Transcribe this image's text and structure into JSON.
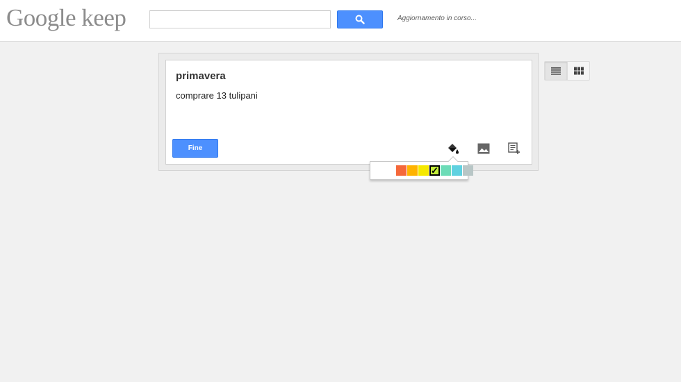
{
  "app": {
    "logo_text": "Google keep",
    "status_text": "Aggiornamento in corso..."
  },
  "search": {
    "value": "",
    "placeholder": "",
    "button_icon": "search-icon"
  },
  "note": {
    "title": "primavera",
    "body": "comprare 13 tulipani",
    "done_label": "Fine",
    "tools": [
      "color-fill-icon",
      "image-icon",
      "checklist-icon"
    ]
  },
  "palette": {
    "colors": [
      "#ffffff",
      "#f5683a",
      "#ffb300",
      "#f5e800",
      "#c4ef3a",
      "#6cdcb7",
      "#5fd1e0",
      "#b8c6c6"
    ],
    "selected_index": 4,
    "selected_icon": "checkmark-icon"
  },
  "view_toggle": {
    "options": [
      "list-view-icon",
      "grid-view-icon"
    ],
    "active": "list-view-icon"
  }
}
